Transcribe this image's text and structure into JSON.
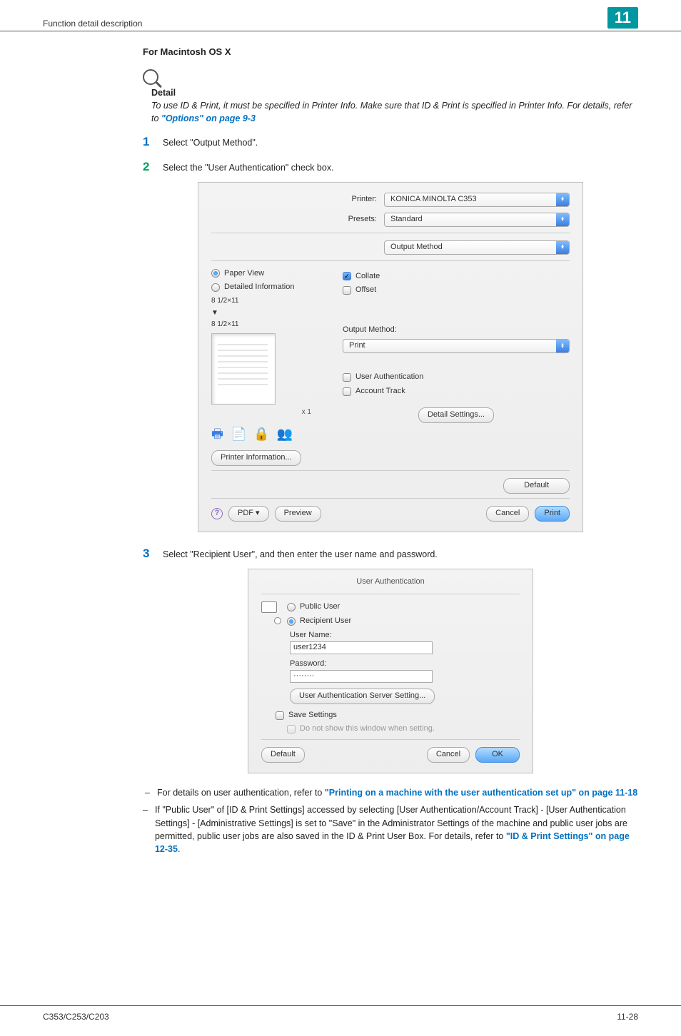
{
  "header": {
    "title": "Function detail description",
    "chapter": "11"
  },
  "section": {
    "os_heading": "For Macintosh OS X",
    "detail_label": "Detail",
    "detail_text_pre": "To use ID & Print, it must be specified in Printer Info. Make sure that ID & Print is specified in Printer Info. For details, refer to ",
    "detail_link": "\"Options\" on page 9-3"
  },
  "steps": {
    "s1": "Select \"Output Method\".",
    "s2": "Select the \"User Authentication\" check box.",
    "s3": "Select \"Recipient User\", and then enter the user name and password."
  },
  "dialog1": {
    "printer_label": "Printer:",
    "printer_value": "KONICA MINOLTA C353",
    "presets_label": "Presets:",
    "presets_value": "Standard",
    "panel_value": "Output Method",
    "paper_view": "Paper View",
    "detailed_info": "Detailed Information",
    "size_top": "8 1/2×11",
    "arrow": "▼",
    "size_bottom": "8 1/2×11",
    "x_count": "x 1",
    "collate": "Collate",
    "offset": "Offset",
    "output_method_label": "Output Method:",
    "output_method_value": "Print",
    "user_auth": "User Authentication",
    "account_track": "Account Track",
    "printer_info_btn": "Printer Information...",
    "detail_settings_btn": "Detail Settings...",
    "default_btn": "Default",
    "pdf_btn": "PDF ▾",
    "preview_btn": "Preview",
    "cancel_btn": "Cancel",
    "print_btn": "Print"
  },
  "dialog2": {
    "title": "User Authentication",
    "public_user": "Public User",
    "recipient_user": "Recipient User",
    "user_name_label": "User Name:",
    "user_name_value": "user1234",
    "password_label": "Password:",
    "password_value": "········",
    "server_setting_btn": "User Authentication Server Setting...",
    "save_settings": "Save Settings",
    "do_not_show": "Do not show this window when setting.",
    "default_btn": "Default",
    "cancel_btn": "Cancel",
    "ok_btn": "OK"
  },
  "notes": {
    "n1_pre": "For details on user authentication, refer to ",
    "n1_link": "\"Printing on a machine with the user authentication set up\" on page 11-18",
    "n2_pre": "If \"Public User\" of [ID & Print Settings] accessed by selecting [User Authentication/Account Track] - [User Authentication Settings] - [Administrative Settings] is set to \"Save\" in the Administrator Settings of the machine and public user jobs are permitted, public user jobs are also saved in the ID & Print User Box. For details, refer to ",
    "n2_link": "\"ID & Print Settings\" on page 12-35",
    "period": "."
  },
  "footer": {
    "left": "C353/C253/C203",
    "right": "11-28"
  }
}
